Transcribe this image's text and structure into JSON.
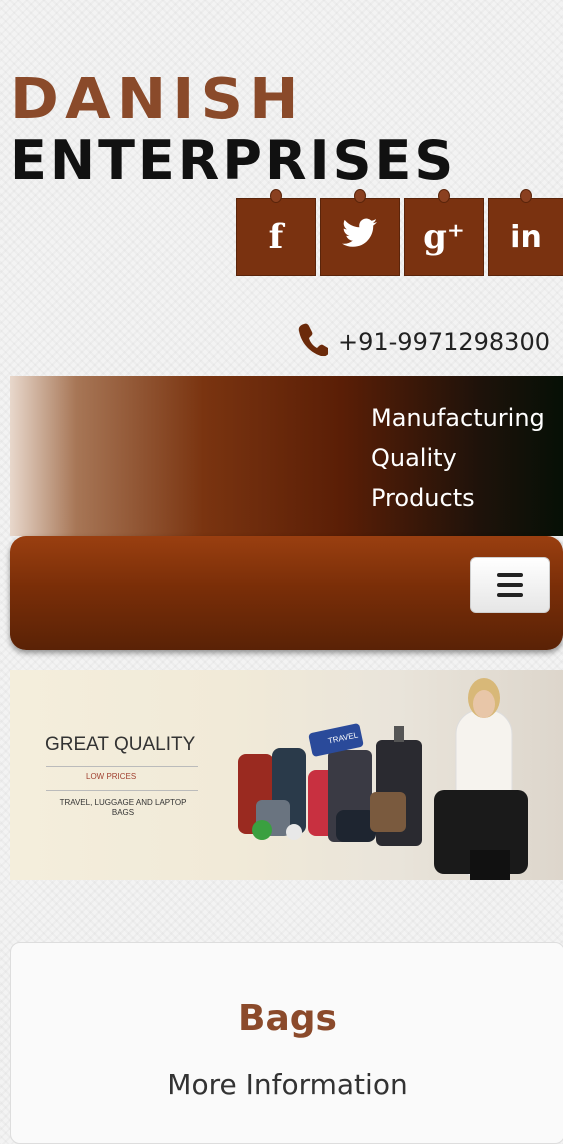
{
  "logo": {
    "line1": "DANISH",
    "line2": "ENTERPRISES"
  },
  "social": [
    {
      "label": "f",
      "icon": "facebook-icon"
    },
    {
      "label": "🐦",
      "icon": "twitter-icon"
    },
    {
      "label": "g⁺",
      "icon": "google-plus-icon"
    },
    {
      "label": "in",
      "icon": "linkedin-icon"
    }
  ],
  "contact": {
    "phone": "+91-9971298300",
    "icon": "phone-icon"
  },
  "banner": {
    "line1": "Manufacturing",
    "line2": "Quality",
    "line3": "Products"
  },
  "navbar": {
    "menu_icon": "hamburger-menu-icon"
  },
  "promo": {
    "title": "GREAT QUALITY",
    "subtitle": "LOW PRICES",
    "desc": "TRAVEL, LUGGAGE AND LAPTOP BAGS",
    "tag": "TRAVEL"
  },
  "card": {
    "title": "Bags",
    "link": "More Information"
  },
  "colors": {
    "brand_brown": "#7a3210",
    "title_brown": "#8b4a2b",
    "logo_brown": "#8a4a2a"
  }
}
